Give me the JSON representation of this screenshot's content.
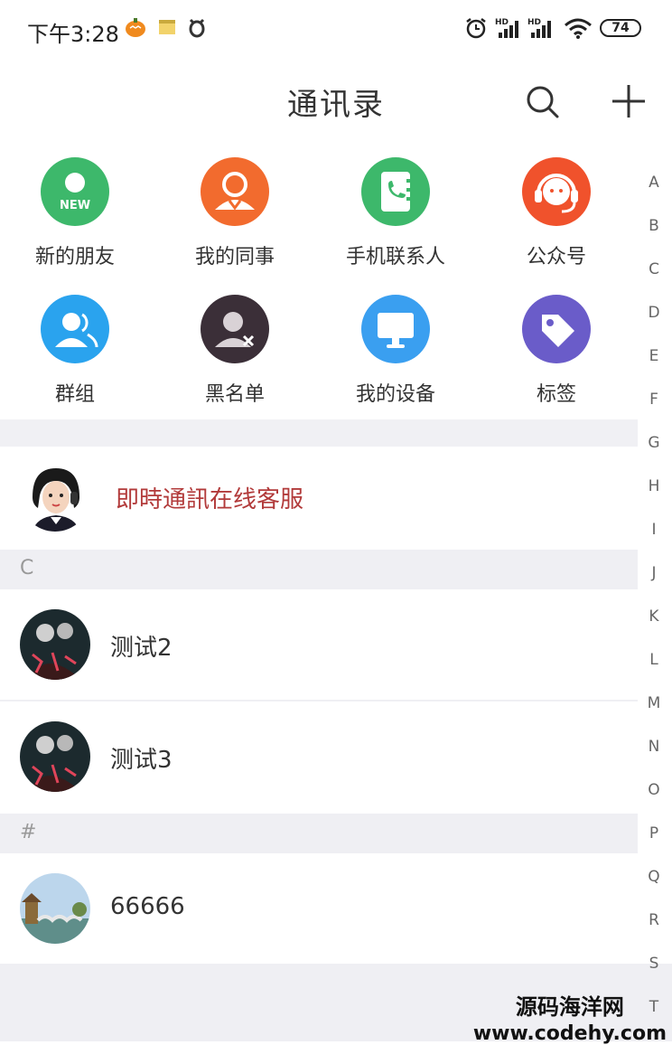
{
  "status_bar": {
    "time": "下午3:28",
    "battery": "74",
    "icons": [
      "pumpkin-icon",
      "note-icon",
      "bug-icon",
      "alarm-icon",
      "signal-hd-icon",
      "signal-hd-icon",
      "wifi-icon",
      "battery-icon"
    ]
  },
  "header": {
    "title": "通讯录",
    "icons": [
      "search-icon",
      "plus-icon"
    ]
  },
  "quick_actions": [
    {
      "label": "新的朋友",
      "color": "#3db86b",
      "icon": "new-friend-icon",
      "badge": "NEW"
    },
    {
      "label": "我的同事",
      "color": "#f26b2e",
      "icon": "colleague-icon"
    },
    {
      "label": "手机联系人",
      "color": "#3db86b",
      "icon": "phone-book-icon"
    },
    {
      "label": "公众号",
      "color": "#f0522c",
      "icon": "headset-icon"
    },
    {
      "label": "群组",
      "color": "#2aa3ee",
      "icon": "group-icon"
    },
    {
      "label": "黑名单",
      "color": "#3b2f38",
      "icon": "blacklist-icon"
    },
    {
      "label": "我的设备",
      "color": "#3a9ff0",
      "icon": "monitor-icon"
    },
    {
      "label": "标签",
      "color": "#6a5cc9",
      "icon": "tag-icon"
    }
  ],
  "service": {
    "name": "即時通訊在线客服",
    "name_color": "#b23a3a"
  },
  "sections": [
    {
      "letter": "C",
      "contacts": [
        "测试2",
        "测试3"
      ]
    },
    {
      "letter": "#",
      "contacts": [
        "66666"
      ]
    }
  ],
  "index_letters": [
    "A",
    "B",
    "C",
    "D",
    "E",
    "F",
    "G",
    "H",
    "I",
    "J",
    "K",
    "L",
    "M",
    "N",
    "O",
    "P",
    "Q",
    "R",
    "S",
    "T"
  ],
  "watermark": {
    "name": "源码海洋网",
    "url": "www.codehy.com"
  }
}
